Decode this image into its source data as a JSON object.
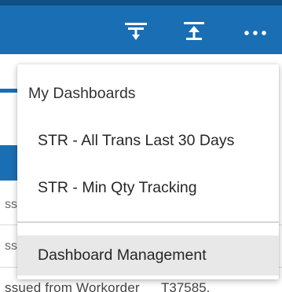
{
  "header": {
    "icons": [
      "filter-down-icon",
      "upload-icon",
      "more-icon"
    ],
    "colors": {
      "bar": "#1a6eb3",
      "strip": "#0e4f86"
    }
  },
  "background": {
    "fragments": [
      "ss",
      "ss"
    ],
    "bottom_text": "ssued from Workorder",
    "bottom_text_right": "T37585."
  },
  "menu": {
    "header": "My Dashboards",
    "items": [
      {
        "label": "STR - All Trans Last 30 Days"
      },
      {
        "label": "STR - Min Qty Tracking"
      }
    ],
    "management": {
      "label": "Dashboard Management"
    }
  }
}
